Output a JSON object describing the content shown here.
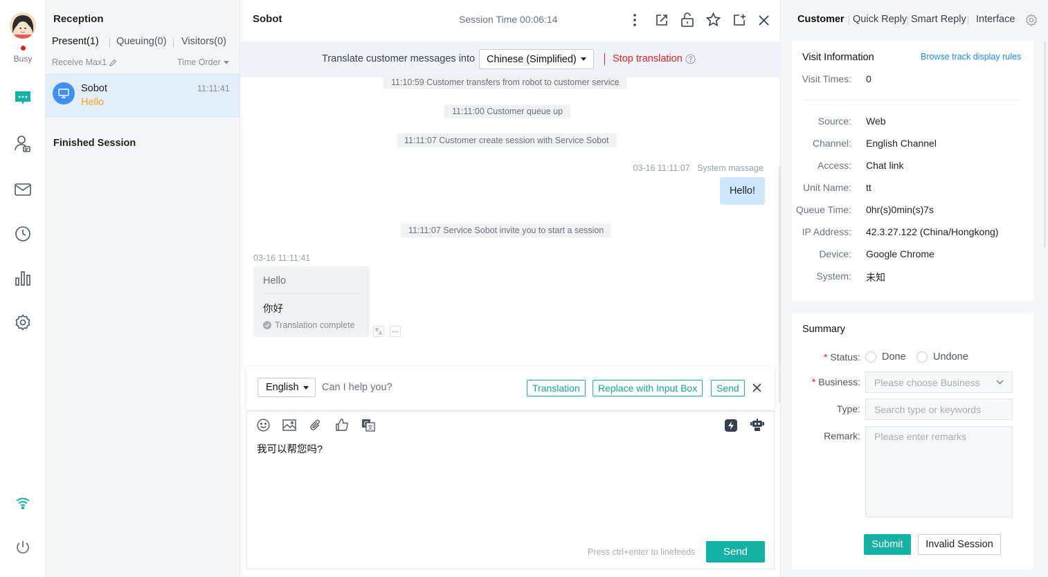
{
  "rail": {
    "status_label": "Busy"
  },
  "list": {
    "title": "Reception",
    "tabs": [
      "Present(1)",
      "Queuing(0)",
      "Visitors(0)"
    ],
    "receive_label": "Receive Max1",
    "order_label": "Time Order",
    "session": {
      "name": "Sobot",
      "time": "11:11:41",
      "preview": "Hello"
    },
    "finished_label": "Finished Session"
  },
  "chat": {
    "title": "Sobot",
    "session_time": "Session Time 00:06:14",
    "translate_label": "Translate customer messages into",
    "translate_lang": "Chinese (Simplified)",
    "stop_translation": "Stop translation",
    "system_messages": [
      "11:10:59 Customer transfers from robot to customer service",
      "11:11:00 Customer queue up",
      "11:11:07 Customer create session with Service Sobot",
      "11:11:07 Service Sobot invite you to start a session"
    ],
    "agent_msg": {
      "meta_time": "03-16 11:11:07",
      "meta_sender": "System massage",
      "text": "Hello!"
    },
    "customer_msg": {
      "time": "03-16 11:11:41",
      "original": "Hello",
      "translated": "你好",
      "status": "Translation complete"
    },
    "translate_bar": {
      "lang": "English",
      "text": "Can I help you?",
      "translation_btn": "Translation",
      "replace_btn": "Replace with Input Box",
      "send_btn": "Send"
    },
    "input_text": "我可以帮您吗?",
    "hint": "Press ctrl+enter to linefeeds",
    "send": "Send"
  },
  "right": {
    "tabs": [
      "Customer",
      "Quick Reply",
      "Smart Reply",
      "Interface"
    ],
    "visit": {
      "title": "Visit Information",
      "rules_link": "Browse track display rules",
      "times_label": "Visit Times",
      "times_value": "0",
      "rows": [
        {
          "label": "Source",
          "value": "Web"
        },
        {
          "label": "Channel",
          "value": "English Channel"
        },
        {
          "label": "Access",
          "value": "Chat link"
        },
        {
          "label": "Unit Name",
          "value": "tt"
        },
        {
          "label": "Queue Time",
          "value": "0hr(s)0min(s)7s"
        },
        {
          "label": "IP Address",
          "value": "42.3.27.122 (China/Hongkong)"
        },
        {
          "label": "Device",
          "value": "Google Chrome"
        },
        {
          "label": "System",
          "value": "未知"
        }
      ]
    },
    "summary": {
      "title": "Summary",
      "status_label": "Status",
      "status_options": [
        "Done",
        "Undone"
      ],
      "business_label": "Business",
      "business_placeholder": "Please choose Business",
      "type_label": "Type",
      "type_placeholder": "Search type or keywords",
      "remark_label": "Remark",
      "remark_placeholder": "Please enter remarks",
      "submit": "Submit",
      "invalid": "Invalid Session"
    }
  },
  "colors": {
    "accent": "#15b1a4",
    "danger": "#e02020",
    "link": "#1e88e5",
    "selected": "#e3eefb"
  }
}
